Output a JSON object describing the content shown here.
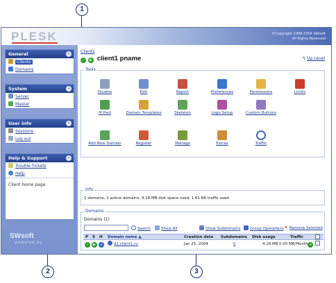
{
  "callouts": [
    "1",
    "2",
    "3"
  ],
  "header": {
    "logo": "PLESK",
    "copyright_line1": "©Copyright 1999-2004 SWsoft",
    "copyright_line2": "All Rights Reserved"
  },
  "sidebar": {
    "blocks": [
      {
        "title": "General",
        "items": [
          {
            "label": "Clients",
            "icon": "clients-icon",
            "active": true
          },
          {
            "label": "Domains",
            "icon": "domains-icon"
          }
        ]
      },
      {
        "title": "System",
        "items": [
          {
            "label": "Server",
            "icon": "server-icon"
          },
          {
            "label": "Master",
            "icon": "master-icon"
          }
        ]
      },
      {
        "title": "User info",
        "items": [
          {
            "label": "Sessions",
            "icon": "sessions-icon"
          },
          {
            "label": "Log out",
            "icon": "logout-icon"
          }
        ]
      },
      {
        "title": "Help & Support",
        "items": [
          {
            "label": "Trouble Tickets",
            "icon": "tickets-icon"
          },
          {
            "label": "Help",
            "icon": "help-icon"
          }
        ],
        "hint": "Client home page."
      }
    ],
    "brand": "SWsoft",
    "brand_sub": "powered by"
  },
  "main": {
    "breadcrumb": "Clients",
    "title": "client1 pname",
    "up_level": "Up Level",
    "tools_legend": "Tools",
    "tools_row1": [
      "Disable",
      "Edit",
      "Report",
      "Preferences",
      "Permissions",
      "Limits"
    ],
    "tools_row2": [
      "IP Pool",
      "Domain Templates",
      "Skeleton",
      "Logo Setup",
      "Custom Buttons"
    ],
    "tools_row3": [
      "Add New Domain",
      "Register",
      "Manage",
      "Extras",
      "Traffic"
    ],
    "info_legend": "Info",
    "info_text": "1 domains, 1 active domains, 4.18 MB disk space used, 1.61 KB traffic used",
    "domains_legend": "Domains",
    "domains_count": "Domains (1)",
    "search_label": "Search",
    "show_all": "Show All",
    "show_subdomains": "Show Subdomains",
    "group_operations": "Group Operations",
    "remove_selected": "Remove Selected",
    "columns": {
      "p": "P",
      "s": "S",
      "h": "H",
      "domain_name": "Domain name ▲",
      "creation_date": "Creation date",
      "subdomains": "Subdomains",
      "disk_usage": "Disk usage",
      "traffic": "Traffic"
    },
    "rows": [
      {
        "domain": "d1.client1.ru",
        "created": "Jan 25, 2004",
        "subdomains": "0",
        "disk": "4.18 MB",
        "traffic": "0.00 MB/Month"
      }
    ]
  },
  "colors": {
    "header_blue": "#22408a",
    "sidebar_bg": "#8fa4d6",
    "link": "#1d3a8f",
    "logo_red": "#d23a2c"
  }
}
